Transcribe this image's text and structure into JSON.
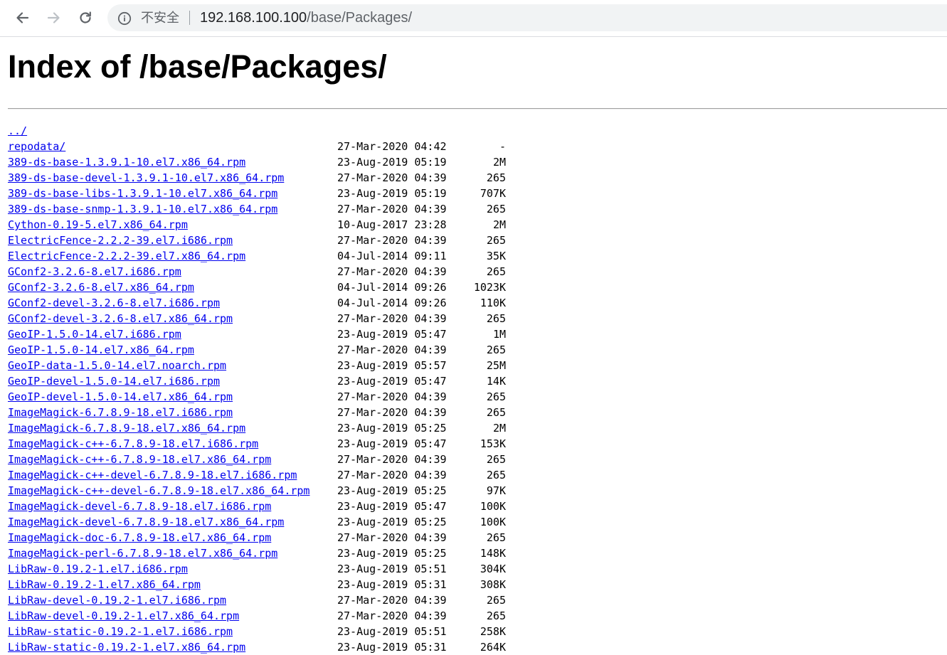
{
  "browser": {
    "security_label": "不安全",
    "url_host": "192.168.100.100",
    "url_path": "/base/Packages/",
    "icons": [
      "back-arrow-icon",
      "forward-arrow-icon",
      "reload-icon",
      "info-icon"
    ]
  },
  "page": {
    "title": "Index of /base/Packages/"
  },
  "listing": {
    "rows": [
      {
        "name": "../",
        "date": "",
        "size": ""
      },
      {
        "name": "repodata/",
        "date": "27-Mar-2020 04:42",
        "size": "-"
      },
      {
        "name": "389-ds-base-1.3.9.1-10.el7.x86_64.rpm",
        "date": "23-Aug-2019 05:19",
        "size": "2M"
      },
      {
        "name": "389-ds-base-devel-1.3.9.1-10.el7.x86_64.rpm",
        "date": "27-Mar-2020 04:39",
        "size": "265"
      },
      {
        "name": "389-ds-base-libs-1.3.9.1-10.el7.x86_64.rpm",
        "date": "23-Aug-2019 05:19",
        "size": "707K"
      },
      {
        "name": "389-ds-base-snmp-1.3.9.1-10.el7.x86_64.rpm",
        "date": "27-Mar-2020 04:39",
        "size": "265"
      },
      {
        "name": "Cython-0.19-5.el7.x86_64.rpm",
        "date": "10-Aug-2017 23:28",
        "size": "2M"
      },
      {
        "name": "ElectricFence-2.2.2-39.el7.i686.rpm",
        "date": "27-Mar-2020 04:39",
        "size": "265"
      },
      {
        "name": "ElectricFence-2.2.2-39.el7.x86_64.rpm",
        "date": "04-Jul-2014 09:11",
        "size": "35K"
      },
      {
        "name": "GConf2-3.2.6-8.el7.i686.rpm",
        "date": "27-Mar-2020 04:39",
        "size": "265"
      },
      {
        "name": "GConf2-3.2.6-8.el7.x86_64.rpm",
        "date": "04-Jul-2014 09:26",
        "size": "1023K"
      },
      {
        "name": "GConf2-devel-3.2.6-8.el7.i686.rpm",
        "date": "04-Jul-2014 09:26",
        "size": "110K"
      },
      {
        "name": "GConf2-devel-3.2.6-8.el7.x86_64.rpm",
        "date": "27-Mar-2020 04:39",
        "size": "265"
      },
      {
        "name": "GeoIP-1.5.0-14.el7.i686.rpm",
        "date": "23-Aug-2019 05:47",
        "size": "1M"
      },
      {
        "name": "GeoIP-1.5.0-14.el7.x86_64.rpm",
        "date": "27-Mar-2020 04:39",
        "size": "265"
      },
      {
        "name": "GeoIP-data-1.5.0-14.el7.noarch.rpm",
        "date": "23-Aug-2019 05:57",
        "size": "25M"
      },
      {
        "name": "GeoIP-devel-1.5.0-14.el7.i686.rpm",
        "date": "23-Aug-2019 05:47",
        "size": "14K"
      },
      {
        "name": "GeoIP-devel-1.5.0-14.el7.x86_64.rpm",
        "date": "27-Mar-2020 04:39",
        "size": "265"
      },
      {
        "name": "ImageMagick-6.7.8.9-18.el7.i686.rpm",
        "date": "27-Mar-2020 04:39",
        "size": "265"
      },
      {
        "name": "ImageMagick-6.7.8.9-18.el7.x86_64.rpm",
        "date": "23-Aug-2019 05:25",
        "size": "2M"
      },
      {
        "name": "ImageMagick-c++-6.7.8.9-18.el7.i686.rpm",
        "date": "23-Aug-2019 05:47",
        "size": "153K"
      },
      {
        "name": "ImageMagick-c++-6.7.8.9-18.el7.x86_64.rpm",
        "date": "27-Mar-2020 04:39",
        "size": "265"
      },
      {
        "name": "ImageMagick-c++-devel-6.7.8.9-18.el7.i686.rpm",
        "date": "27-Mar-2020 04:39",
        "size": "265"
      },
      {
        "name": "ImageMagick-c++-devel-6.7.8.9-18.el7.x86_64.rpm",
        "date": "23-Aug-2019 05:25",
        "size": "97K"
      },
      {
        "name": "ImageMagick-devel-6.7.8.9-18.el7.i686.rpm",
        "date": "23-Aug-2019 05:47",
        "size": "100K"
      },
      {
        "name": "ImageMagick-devel-6.7.8.9-18.el7.x86_64.rpm",
        "date": "23-Aug-2019 05:25",
        "size": "100K"
      },
      {
        "name": "ImageMagick-doc-6.7.8.9-18.el7.x86_64.rpm",
        "date": "27-Mar-2020 04:39",
        "size": "265"
      },
      {
        "name": "ImageMagick-perl-6.7.8.9-18.el7.x86_64.rpm",
        "date": "23-Aug-2019 05:25",
        "size": "148K"
      },
      {
        "name": "LibRaw-0.19.2-1.el7.i686.rpm",
        "date": "23-Aug-2019 05:51",
        "size": "304K"
      },
      {
        "name": "LibRaw-0.19.2-1.el7.x86_64.rpm",
        "date": "23-Aug-2019 05:31",
        "size": "308K"
      },
      {
        "name": "LibRaw-devel-0.19.2-1.el7.i686.rpm",
        "date": "27-Mar-2020 04:39",
        "size": "265"
      },
      {
        "name": "LibRaw-devel-0.19.2-1.el7.x86_64.rpm",
        "date": "27-Mar-2020 04:39",
        "size": "265"
      },
      {
        "name": "LibRaw-static-0.19.2-1.el7.i686.rpm",
        "date": "23-Aug-2019 05:51",
        "size": "258K"
      },
      {
        "name": "LibRaw-static-0.19.2-1.el7.x86_64.rpm",
        "date": "23-Aug-2019 05:31",
        "size": "264K"
      }
    ]
  }
}
